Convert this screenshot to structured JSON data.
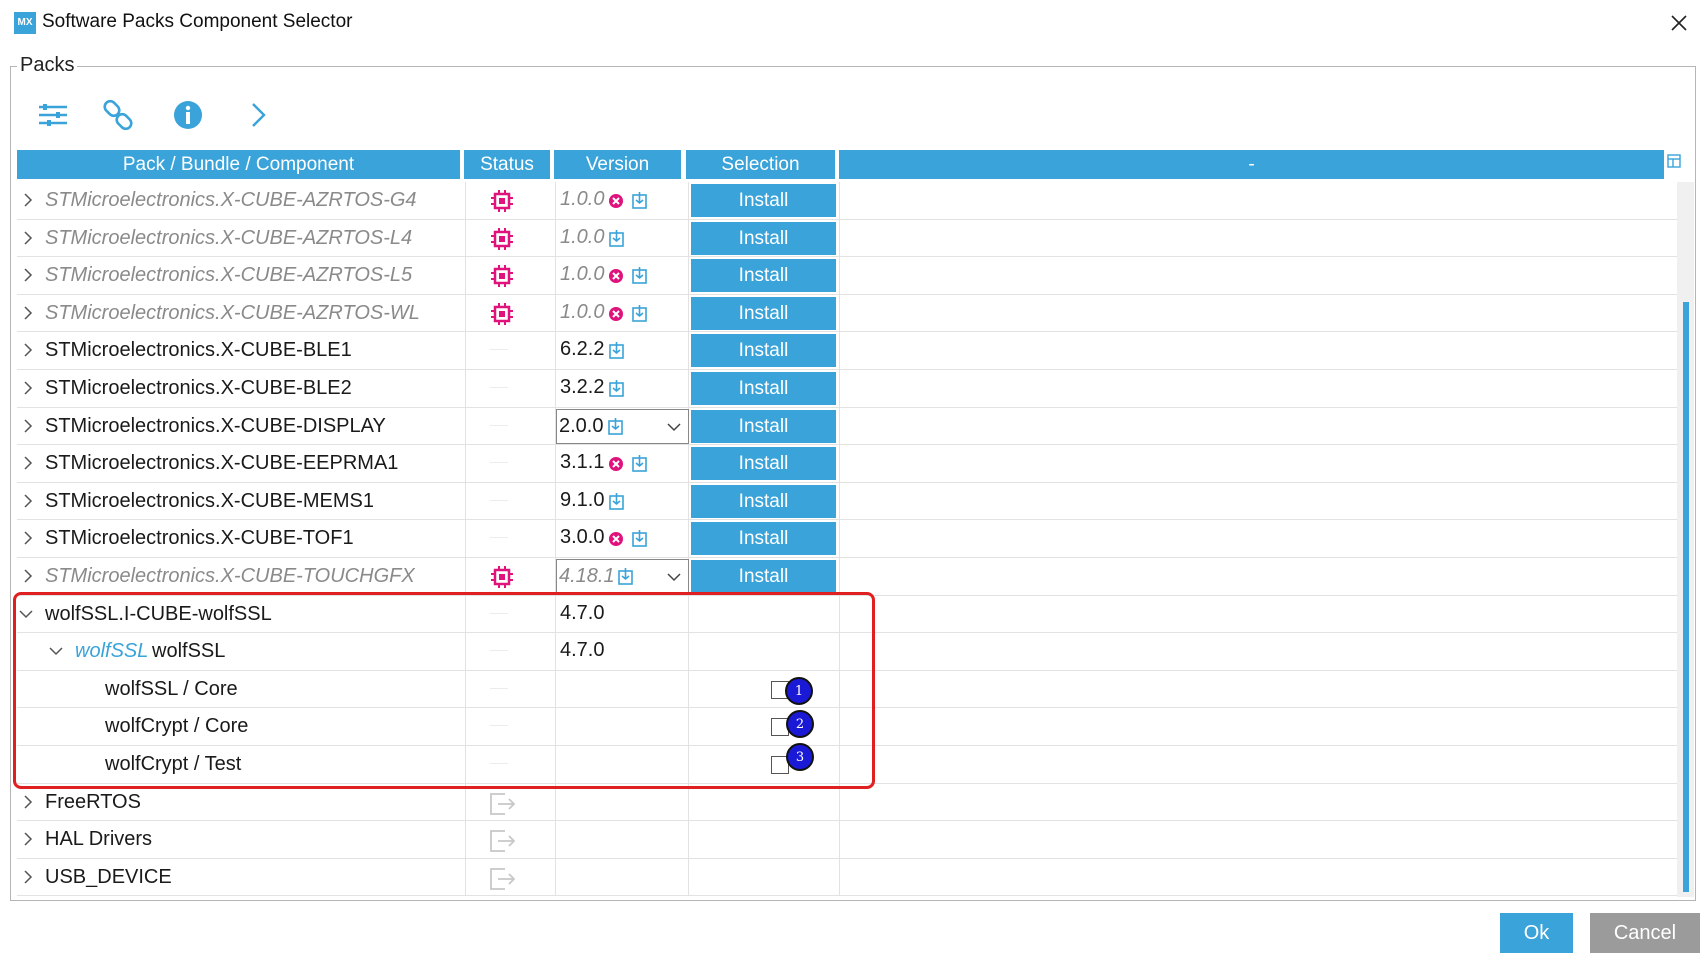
{
  "window": {
    "title": "Software Packs Component Selector",
    "app_icon": "MX"
  },
  "group_label": "Packs",
  "toolbar": {
    "icons": [
      "filter-icon",
      "link-icon",
      "info-icon",
      "expand-right-icon"
    ]
  },
  "columns": {
    "name": "Pack / Bundle / Component",
    "status": "Status",
    "version": "Version",
    "selection": "Selection",
    "extra": "-"
  },
  "rows": [
    {
      "name": "STMicroelectronics.X-CUBE-AZRTOS-G4",
      "version": "1.0.0",
      "action": "Install"
    },
    {
      "name": "STMicroelectronics.X-CUBE-AZRTOS-L4",
      "version": "1.0.0",
      "action": "Install"
    },
    {
      "name": "STMicroelectronics.X-CUBE-AZRTOS-L5",
      "version": "1.0.0",
      "action": "Install"
    },
    {
      "name": "STMicroelectronics.X-CUBE-AZRTOS-WL",
      "version": "1.0.0",
      "action": "Install"
    },
    {
      "name": "STMicroelectronics.X-CUBE-BLE1",
      "version": "6.2.2",
      "action": "Install"
    },
    {
      "name": "STMicroelectronics.X-CUBE-BLE2",
      "version": "3.2.2",
      "action": "Install"
    },
    {
      "name": "STMicroelectronics.X-CUBE-DISPLAY",
      "version": "2.0.0",
      "action": "Install"
    },
    {
      "name": "STMicroelectronics.X-CUBE-EEPRMA1",
      "version": "3.1.1",
      "action": "Install"
    },
    {
      "name": "STMicroelectronics.X-CUBE-MEMS1",
      "version": "9.1.0",
      "action": "Install"
    },
    {
      "name": "STMicroelectronics.X-CUBE-TOF1",
      "version": "3.0.0",
      "action": "Install"
    },
    {
      "name": "STMicroelectronics.X-CUBE-TOUCHGFX",
      "version": "4.18.1",
      "action": "Install"
    },
    {
      "name": "wolfSSL.I-CUBE-wolfSSL",
      "version": "4.7.0"
    },
    {
      "name_prefix": "wolfSSL",
      "name": "wolfSSL",
      "version": "4.7.0"
    },
    {
      "name": "wolfSSL / Core",
      "badge": "1"
    },
    {
      "name": "wolfCrypt / Core",
      "badge": "2"
    },
    {
      "name": "wolfCrypt / Test",
      "badge": "3"
    },
    {
      "name": "FreeRTOS"
    },
    {
      "name": "HAL Drivers"
    },
    {
      "name": "USB_DEVICE"
    }
  ],
  "buttons": {
    "ok": "Ok",
    "cancel": "Cancel"
  },
  "colors": {
    "accent": "#3aa3d9",
    "chip": "#e0127c",
    "error": "#e0127c",
    "highlight_box": "#e02020",
    "badge": "#1a1ad6"
  }
}
